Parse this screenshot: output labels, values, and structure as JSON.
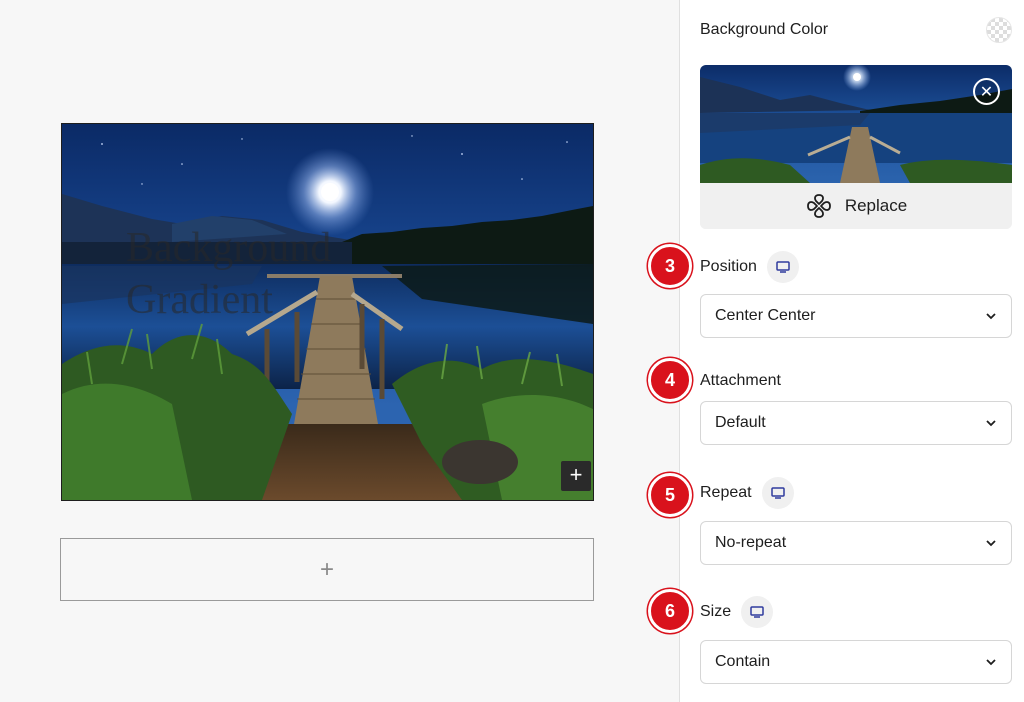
{
  "canvas": {
    "cover_text": "Background Gradient",
    "block_add_icon": "plus-icon",
    "appender_icon": "plus-icon"
  },
  "sidebar": {
    "background_color": {
      "label": "Background Color",
      "swatch_icon": "transparent-swatch-icon"
    },
    "media": {
      "remove_icon": "close-circle-icon",
      "replace_label": "Replace",
      "replace_icon": "replace-icon"
    },
    "fields": [
      {
        "step": "3",
        "label": "Position",
        "has_device_toggle": true,
        "value": "Center Center"
      },
      {
        "step": "4",
        "label": "Attachment",
        "has_device_toggle": false,
        "value": "Default"
      },
      {
        "step": "5",
        "label": "Repeat",
        "has_device_toggle": true,
        "value": "No-repeat"
      },
      {
        "step": "6",
        "label": "Size",
        "has_device_toggle": true,
        "value": "Contain"
      }
    ]
  },
  "colors": {
    "marker_red": "#d9121c",
    "device_icon": "#2f3a9e",
    "sidebar_bg": "#ffffff",
    "canvas_bg": "#f7f7f7"
  }
}
